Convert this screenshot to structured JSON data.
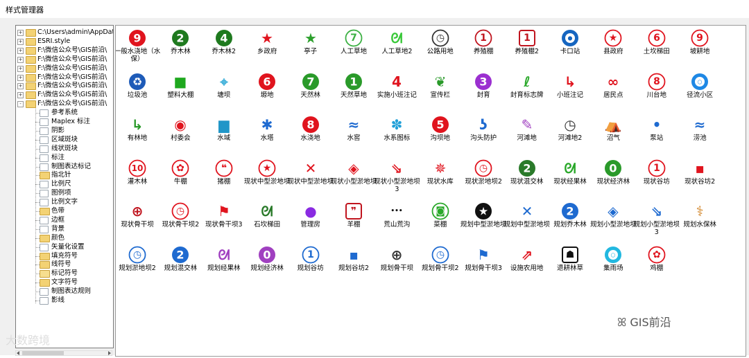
{
  "window": {
    "title": "样式管理器"
  },
  "tree": {
    "items": [
      {
        "label": "C:\\Users\\admin\\AppData\\",
        "kind": "folder",
        "level": 0,
        "expander": "+"
      },
      {
        "label": "ESRI.style",
        "kind": "folder",
        "level": 0,
        "expander": "+"
      },
      {
        "label": "F:\\微信公众号\\GIS前沿\\",
        "kind": "folder",
        "level": 0,
        "expander": "+"
      },
      {
        "label": "F:\\微信公众号\\GIS前沿\\",
        "kind": "folder",
        "level": 0,
        "expander": "+"
      },
      {
        "label": "F:\\微信公众号\\GIS前沿\\",
        "kind": "folder",
        "level": 0,
        "expander": "+"
      },
      {
        "label": "F:\\微信公众号\\GIS前沿\\",
        "kind": "folder",
        "level": 0,
        "expander": "+"
      },
      {
        "label": "F:\\微信公众号\\GIS前沿\\",
        "kind": "folder",
        "level": 0,
        "expander": "+"
      },
      {
        "label": "F:\\微信公众号\\GIS前沿\\",
        "kind": "folder",
        "level": 0,
        "expander": "+"
      },
      {
        "label": "F:\\微信公众号\\GIS前沿\\",
        "kind": "folder",
        "level": 0,
        "expander": "-"
      },
      {
        "label": "参考系统",
        "kind": "page",
        "level": 1
      },
      {
        "label": "Maplex 标注",
        "kind": "page",
        "level": 1
      },
      {
        "label": "阴影",
        "kind": "page",
        "level": 1
      },
      {
        "label": "区域斑块",
        "kind": "page",
        "level": 1
      },
      {
        "label": "线状斑块",
        "kind": "page",
        "level": 1
      },
      {
        "label": "标注",
        "kind": "page",
        "level": 1
      },
      {
        "label": "制图表达标记",
        "kind": "page",
        "level": 1
      },
      {
        "label": "指北针",
        "kind": "folder",
        "level": 1
      },
      {
        "label": "比例尺",
        "kind": "page",
        "level": 1
      },
      {
        "label": "图例项",
        "kind": "page",
        "level": 1
      },
      {
        "label": "比例文字",
        "kind": "page",
        "level": 1
      },
      {
        "label": "色带",
        "kind": "folder",
        "level": 1
      },
      {
        "label": "边框",
        "kind": "page",
        "level": 1
      },
      {
        "label": "背景",
        "kind": "page",
        "level": 1
      },
      {
        "label": "颜色",
        "kind": "folder",
        "level": 1
      },
      {
        "label": "矢量化设置",
        "kind": "page",
        "level": 1
      },
      {
        "label": "填充符号",
        "kind": "folder",
        "level": 1
      },
      {
        "label": "线符号",
        "kind": "folder",
        "level": 1
      },
      {
        "label": "标记符号",
        "kind": "open",
        "level": 1
      },
      {
        "label": "文字符号",
        "kind": "folder",
        "level": 1
      },
      {
        "label": "制图表达规则",
        "kind": "page",
        "level": 1
      },
      {
        "label": "影线",
        "kind": "page",
        "level": 1
      }
    ]
  },
  "symbols": [
    {
      "label": "一般水浇地（水保）",
      "icon": "red-disc-9-icon",
      "shape": "disc",
      "color": "#e0141e",
      "glyph": "9"
    },
    {
      "label": "乔木林",
      "icon": "green-disc-2-icon",
      "shape": "disc",
      "color": "#1f7a1f",
      "glyph": "2"
    },
    {
      "label": "乔木林2",
      "icon": "green-disc-4-icon",
      "shape": "disc",
      "color": "#1f7a1f",
      "glyph": "4"
    },
    {
      "label": "乡政府",
      "icon": "red-small-star-icon",
      "shape": "text",
      "color": "#e0141e",
      "glyph": "★"
    },
    {
      "label": "亭子",
      "icon": "green-star-icon",
      "shape": "text",
      "color": "#2ca02c",
      "glyph": "★"
    },
    {
      "label": "人工草地",
      "icon": "green-ring-7-icon",
      "shape": "ring",
      "color": "#3cb043",
      "glyph": "7"
    },
    {
      "label": "人工草地2",
      "icon": "green-swirl-icon",
      "shape": "text",
      "color": "#39c839",
      "glyph": "ᘛ"
    },
    {
      "label": "公路用地",
      "icon": "clock-icon",
      "shape": "ring",
      "color": "#333333",
      "glyph": "◷"
    },
    {
      "label": "养殖棚",
      "icon": "red-ring-1-icon",
      "shape": "ring",
      "color": "#c0141e",
      "glyph": "1"
    },
    {
      "label": "养殖棚2",
      "icon": "red-box-1-icon",
      "shape": "box",
      "color": "#c0141e",
      "glyph": "1"
    },
    {
      "label": "卡口站",
      "icon": "blue-target-icon",
      "shape": "target",
      "color": "#1565c0",
      "glyph": "●"
    },
    {
      "label": "县政府",
      "icon": "red-star-circle-icon",
      "shape": "ring",
      "color": "#e0141e",
      "glyph": "★"
    },
    {
      "label": "土坎梯田",
      "icon": "red-ring-6-icon",
      "shape": "ring",
      "color": "#e0141e",
      "glyph": "6"
    },
    {
      "label": "坡耕地",
      "icon": "red-ring-9-icon",
      "shape": "ring",
      "color": "#e0141e",
      "glyph": "9"
    },
    {
      "label": "垃圾池",
      "icon": "blue-recycle-icon",
      "shape": "disc",
      "color": "#1e5bb8",
      "glyph": "♻"
    },
    {
      "label": "塑料大棚",
      "icon": "green-square-icon",
      "shape": "text",
      "color": "#1ea81e",
      "glyph": "■"
    },
    {
      "label": "塘坝",
      "icon": "cyan-cross-icon",
      "shape": "text",
      "color": "#3aaed8",
      "glyph": "⌖"
    },
    {
      "label": "塬地",
      "icon": "red-disc-6-icon",
      "shape": "disc",
      "color": "#e0141e",
      "glyph": "6"
    },
    {
      "label": "天然林",
      "icon": "green-disc-7-icon",
      "shape": "disc",
      "color": "#2a9a2a",
      "glyph": "7"
    },
    {
      "label": "天然草地",
      "icon": "green-disc-1-icon",
      "shape": "disc",
      "color": "#2a9a2a",
      "glyph": "1"
    },
    {
      "label": "实施小班注记",
      "icon": "red-4-icon",
      "shape": "text",
      "color": "#e0141e",
      "glyph": "4"
    },
    {
      "label": "宣传栏",
      "icon": "green-flower-icon",
      "shape": "text",
      "color": "#2a9a2a",
      "glyph": "❦"
    },
    {
      "label": "封育",
      "icon": "purple-disc-3-icon",
      "shape": "disc",
      "color": "#9b30d0",
      "glyph": "3"
    },
    {
      "label": "封育标志牌",
      "icon": "green-sprout-icon",
      "shape": "text",
      "color": "#2aa82a",
      "glyph": "ℓ"
    },
    {
      "label": "小班注记",
      "icon": "red-hook-icon",
      "shape": "text",
      "color": "#e0141e",
      "glyph": "↳"
    },
    {
      "label": "居民点",
      "icon": "red-knot-icon",
      "shape": "text",
      "color": "#e0141e",
      "glyph": "∞"
    },
    {
      "label": "川台地",
      "icon": "red-ring-8-icon",
      "shape": "ring",
      "color": "#e0141e",
      "glyph": "8"
    },
    {
      "label": "径流小区",
      "icon": "blue-donut-icon",
      "shape": "target",
      "color": "#1e88e5",
      "glyph": "○"
    },
    {
      "label": "有林地",
      "icon": "green-arrow-icon",
      "shape": "text",
      "color": "#2a9a2a",
      "glyph": "↳"
    },
    {
      "label": "村委会",
      "icon": "red-dot-ring-icon",
      "shape": "text",
      "color": "#e0141e",
      "glyph": "◉"
    },
    {
      "label": "水域",
      "icon": "blue-castle-icon",
      "shape": "text",
      "color": "#2196c8",
      "glyph": "▆"
    },
    {
      "label": "水塔",
      "icon": "blue-star-icon",
      "shape": "text",
      "color": "#1e6ad0",
      "glyph": "✱"
    },
    {
      "label": "水浇地",
      "icon": "red-disc-8-icon",
      "shape": "disc",
      "color": "#e0141e",
      "glyph": "8"
    },
    {
      "label": "水窖",
      "icon": "blue-wave-icon",
      "shape": "text",
      "color": "#1e6ad0",
      "glyph": "≈"
    },
    {
      "label": "水系图标",
      "icon": "cyan-blob-icon",
      "shape": "text",
      "color": "#22a0d8",
      "glyph": "✽"
    },
    {
      "label": "沟坝地",
      "icon": "red-disc-5-icon",
      "shape": "disc",
      "color": "#e0141e",
      "glyph": "5"
    },
    {
      "label": "沟头防护",
      "icon": "blue-hook-icon",
      "shape": "text",
      "color": "#1e6ad0",
      "glyph": "ʖ"
    },
    {
      "label": "河滩地",
      "icon": "purple-pencil-icon",
      "shape": "text",
      "color": "#a040c0",
      "glyph": "✎"
    },
    {
      "label": "河滩地2",
      "icon": "clock-small-icon",
      "shape": "text",
      "color": "#333333",
      "glyph": "◷"
    },
    {
      "label": "沼气",
      "icon": "gray-tent-icon",
      "shape": "text",
      "color": "#777777",
      "glyph": "⛺"
    },
    {
      "label": "泵站",
      "icon": "blue-dot-icon",
      "shape": "text",
      "color": "#1e6ad0",
      "glyph": "•"
    },
    {
      "label": "涝池",
      "icon": "blue-wave2-icon",
      "shape": "text",
      "color": "#1e6ad0",
      "glyph": "≈"
    },
    {
      "label": "灌木林",
      "icon": "red-ring-10-icon",
      "shape": "ring",
      "color": "#e0141e",
      "glyph": "10"
    },
    {
      "label": "牛棚",
      "icon": "red-bull-icon",
      "shape": "ring",
      "color": "#e0141e",
      "glyph": "✿"
    },
    {
      "label": "猪棚",
      "icon": "red-quote-icon",
      "shape": "ring",
      "color": "#e0141e",
      "glyph": "❝"
    },
    {
      "label": "现状中型淤地坝",
      "icon": "black-star-disc-icon",
      "shape": "ring",
      "color": "#e0141e",
      "glyph": "★"
    },
    {
      "label": "现状中型淤地坝",
      "icon": "red-x-icon",
      "shape": "text",
      "color": "#e0141e",
      "glyph": "✕"
    },
    {
      "label": "现状小型淤地坝",
      "icon": "red-diamond-icon",
      "shape": "text",
      "color": "#e0141e",
      "glyph": "◈"
    },
    {
      "label": "现状小型淤地坝3",
      "icon": "red-arrow-icon",
      "shape": "text",
      "color": "#e0141e",
      "glyph": "⇘"
    },
    {
      "label": "现状水库",
      "icon": "red-snowflake-icon",
      "shape": "text",
      "color": "#e0141e",
      "glyph": "✵"
    },
    {
      "label": "现状淤地坝2",
      "icon": "red-clock-icon",
      "shape": "ring",
      "color": "#e0141e",
      "glyph": "◷"
    },
    {
      "label": "现状混交林",
      "icon": "green-2-fork-icon",
      "shape": "disc",
      "color": "#2a7a2a",
      "glyph": "2"
    },
    {
      "label": "现状经果林",
      "icon": "green-link-icon",
      "shape": "text",
      "color": "#2aa82a",
      "glyph": "ᘛ"
    },
    {
      "label": "现状经济林",
      "icon": "green-disc-0-icon",
      "shape": "disc",
      "color": "#2a9a2a",
      "glyph": "0"
    },
    {
      "label": "现状谷坊",
      "icon": "red-ring-1b-icon",
      "shape": "ring",
      "color": "#e0141e",
      "glyph": "1"
    },
    {
      "label": "现状谷坊2",
      "icon": "red-small-square-icon",
      "shape": "text",
      "color": "#e0141e",
      "glyph": "▪"
    },
    {
      "label": "现状骨干坝",
      "icon": "crosshair-icon",
      "shape": "text",
      "color": "#c0141e",
      "glyph": "⊕"
    },
    {
      "label": "现状骨干坝2",
      "icon": "red-clock2-icon",
      "shape": "ring",
      "color": "#e0141e",
      "glyph": "◷"
    },
    {
      "label": "现状骨干坝3",
      "icon": "red-flag-icon",
      "shape": "text",
      "color": "#e0141e",
      "glyph": "⚑"
    },
    {
      "label": "石坎梯田",
      "icon": "green-loop-icon",
      "shape": "text",
      "color": "#2a7a2a",
      "glyph": "ᘛ"
    },
    {
      "label": "管理房",
      "icon": "purple-dot-icon",
      "shape": "text",
      "color": "#8a2be2",
      "glyph": "●"
    },
    {
      "label": "羊棚",
      "icon": "red-quote-box-icon",
      "shape": "box",
      "color": "#c0141e",
      "glyph": "❞"
    },
    {
      "label": "荒山荒沟",
      "icon": "three-dots-icon",
      "shape": "text",
      "color": "#111111",
      "glyph": "•••"
    },
    {
      "label": "菜棚",
      "icon": "green-ring-box-icon",
      "shape": "ring",
      "color": "#2aa82a",
      "glyph": "◙"
    },
    {
      "label": "规划中型淤地坝",
      "icon": "blue-star-disc-icon",
      "shape": "disc",
      "color": "#111111",
      "glyph": "★"
    },
    {
      "label": "规划中型淤地坝",
      "icon": "blue-x-icon",
      "shape": "text",
      "color": "#1e6ad0",
      "glyph": "✕"
    },
    {
      "label": "规划乔木林",
      "icon": "blue-disc-2-icon",
      "shape": "disc",
      "color": "#1e6ad0",
      "glyph": "2"
    },
    {
      "label": "规划小型淤地坝",
      "icon": "blue-diamond-icon",
      "shape": "text",
      "color": "#1e6ad0",
      "glyph": "◈"
    },
    {
      "label": "规划小型淤地坝3",
      "icon": "blue-arrow-icon",
      "shape": "text",
      "color": "#1e6ad0",
      "glyph": "⇘"
    },
    {
      "label": "规划水保林",
      "icon": "orange-antenna-icon",
      "shape": "text",
      "color": "#d08020",
      "glyph": "⚕"
    },
    {
      "label": "规划淤地坝2",
      "icon": "blue-clock-icon",
      "shape": "ring",
      "color": "#1e6ad0",
      "glyph": "◷"
    },
    {
      "label": "规划混交林",
      "icon": "blue-2-fork-icon",
      "shape": "disc",
      "color": "#1e6ad0",
      "glyph": "2"
    },
    {
      "label": "规划经果林",
      "icon": "purple-link-icon",
      "shape": "text",
      "color": "#a040c0",
      "glyph": "ᘛ"
    },
    {
      "label": "规划经济林",
      "icon": "purple-disc-0-icon",
      "shape": "disc",
      "color": "#a040c0",
      "glyph": "0"
    },
    {
      "label": "规划谷坊",
      "icon": "blue-ring-1-icon",
      "shape": "ring",
      "color": "#1e6ad0",
      "glyph": "1"
    },
    {
      "label": "规划谷坊2",
      "icon": "blue-small-square-icon",
      "shape": "text",
      "color": "#1e6ad0",
      "glyph": "▪"
    },
    {
      "label": "规划骨干坝",
      "icon": "blue-crosshair-icon",
      "shape": "text",
      "color": "#333333",
      "glyph": "⊕"
    },
    {
      "label": "规划骨干坝2",
      "icon": "blue-clock2-icon",
      "shape": "ring",
      "color": "#1e6ad0",
      "glyph": "◷"
    },
    {
      "label": "规划骨干坝3",
      "icon": "blue-flag-icon",
      "shape": "text",
      "color": "#1e6ad0",
      "glyph": "⚑"
    },
    {
      "label": "设施农用地",
      "icon": "red-arrow-box-icon",
      "shape": "text",
      "color": "#e0141e",
      "glyph": "⇗"
    },
    {
      "label": "退耕林草",
      "icon": "black-face-icon",
      "shape": "box",
      "color": "#111111",
      "glyph": "☗"
    },
    {
      "label": "集雨场",
      "icon": "cyan-ring-icon",
      "shape": "target",
      "color": "#22b8e0",
      "glyph": "○"
    },
    {
      "label": "鸡棚",
      "icon": "red-chicken-icon",
      "shape": "ring",
      "color": "#e0141e",
      "glyph": "✿"
    }
  ],
  "watermark": {
    "brand": "GIS前沿",
    "left": "大数跨境"
  }
}
